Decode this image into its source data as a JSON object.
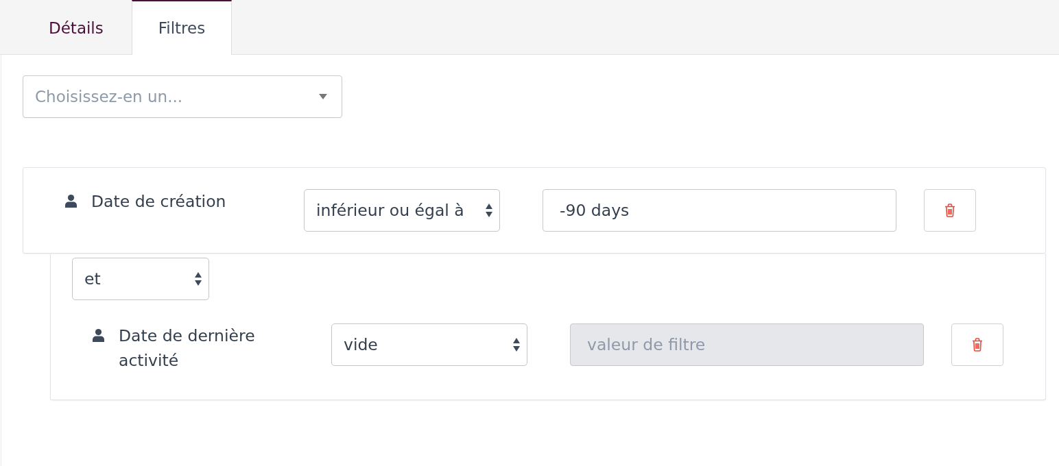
{
  "tabs": [
    {
      "label": "Détails",
      "selected": false
    },
    {
      "label": "Filtres",
      "selected": true
    }
  ],
  "filter_picker": {
    "placeholder": "Choisissez-en un..."
  },
  "filters": [
    {
      "field": "Date de création",
      "operator": "inférieur ou égal à",
      "value": "-90 days",
      "disabled": false,
      "conjunction": "et",
      "children": [
        {
          "field": "Date de dernière activité",
          "operator": "vide",
          "placeholder": "valeur de filtre",
          "disabled": true
        }
      ]
    }
  ]
}
